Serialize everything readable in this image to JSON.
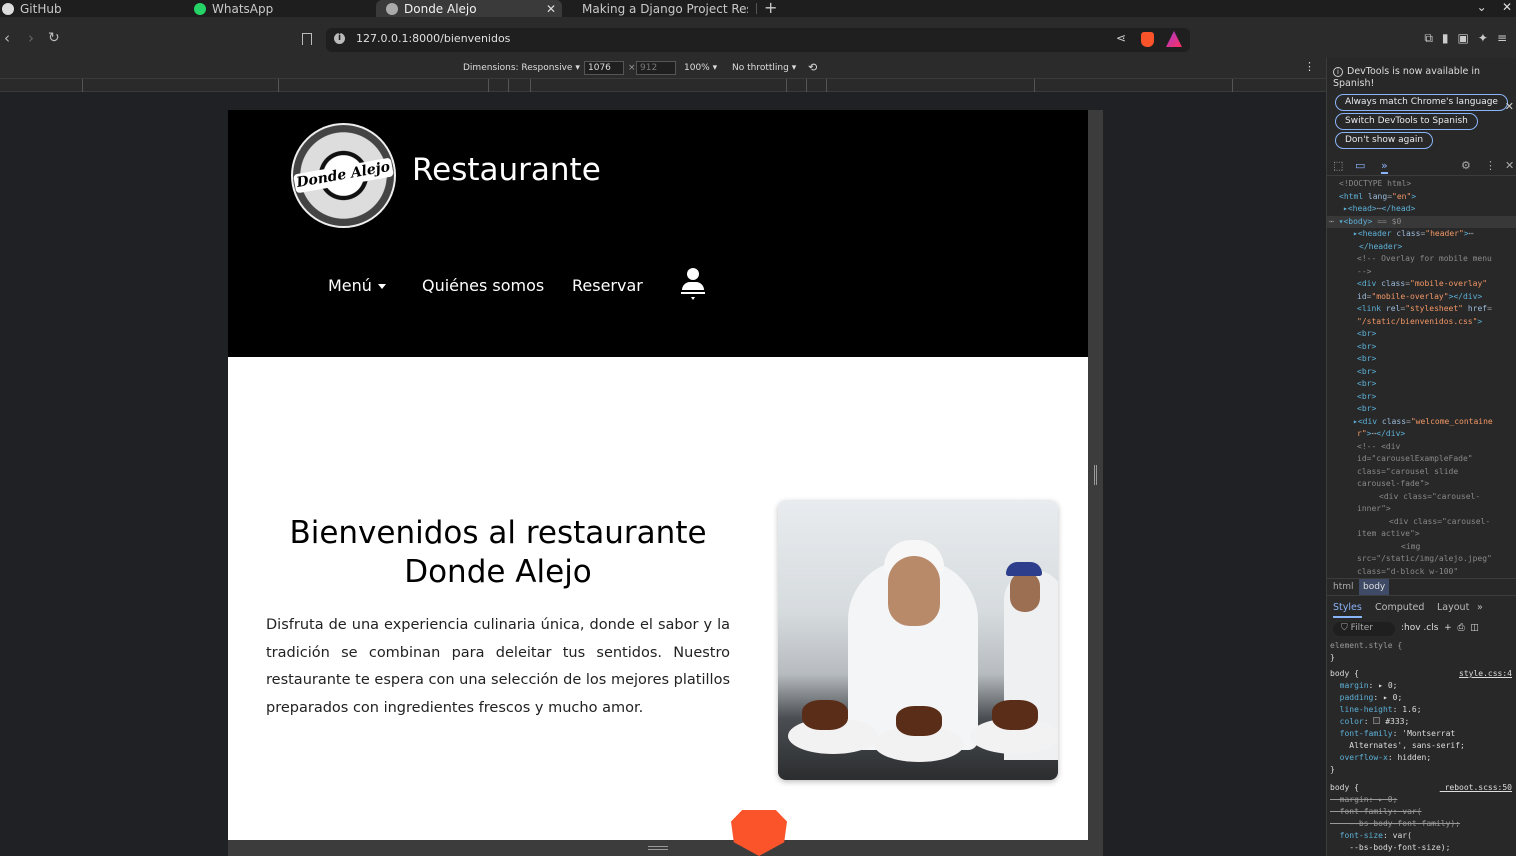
{
  "browser": {
    "tabs": [
      {
        "title": "GitHub"
      },
      {
        "title": "WhatsApp"
      },
      {
        "title": "Donde Alejo",
        "active": true
      },
      {
        "title": "Making a Django Project Res"
      }
    ],
    "url": "127.0.0.1:8000/bienvenidos"
  },
  "device_toolbar": {
    "dimensions_label": "Dimensions: Responsive",
    "width": "1076",
    "height": "912",
    "zoom": "100%",
    "throttling": "No throttling"
  },
  "site": {
    "logo_text": "Donde Alejo",
    "brand": "Restaurante",
    "nav": {
      "menu": "Menú",
      "about": "Quiénes somos",
      "reserve": "Reservar"
    },
    "welcome_title": "Bienvenidos al restaurante Donde Alejo",
    "welcome_text": "Disfruta de una experiencia culinaria única, donde el sabor y la tradición se combinan para deleitar tus sentidos. Nuestro restaurante te espera con una selección de los mejores platillos preparados con ingredientes frescos y mucho amor."
  },
  "devtools": {
    "notice": "DevTools is now available in Spanish!",
    "btn_always": "Always match Chrome's language",
    "btn_switch": "Switch DevTools to Spanish",
    "btn_dont": "Don't show again",
    "crumb_html": "html",
    "crumb_body": "body",
    "tab_styles": "Styles",
    "tab_computed": "Computed",
    "tab_layout": "Layout",
    "filter": "Filter",
    "hov_cls": ":hov .cls"
  }
}
